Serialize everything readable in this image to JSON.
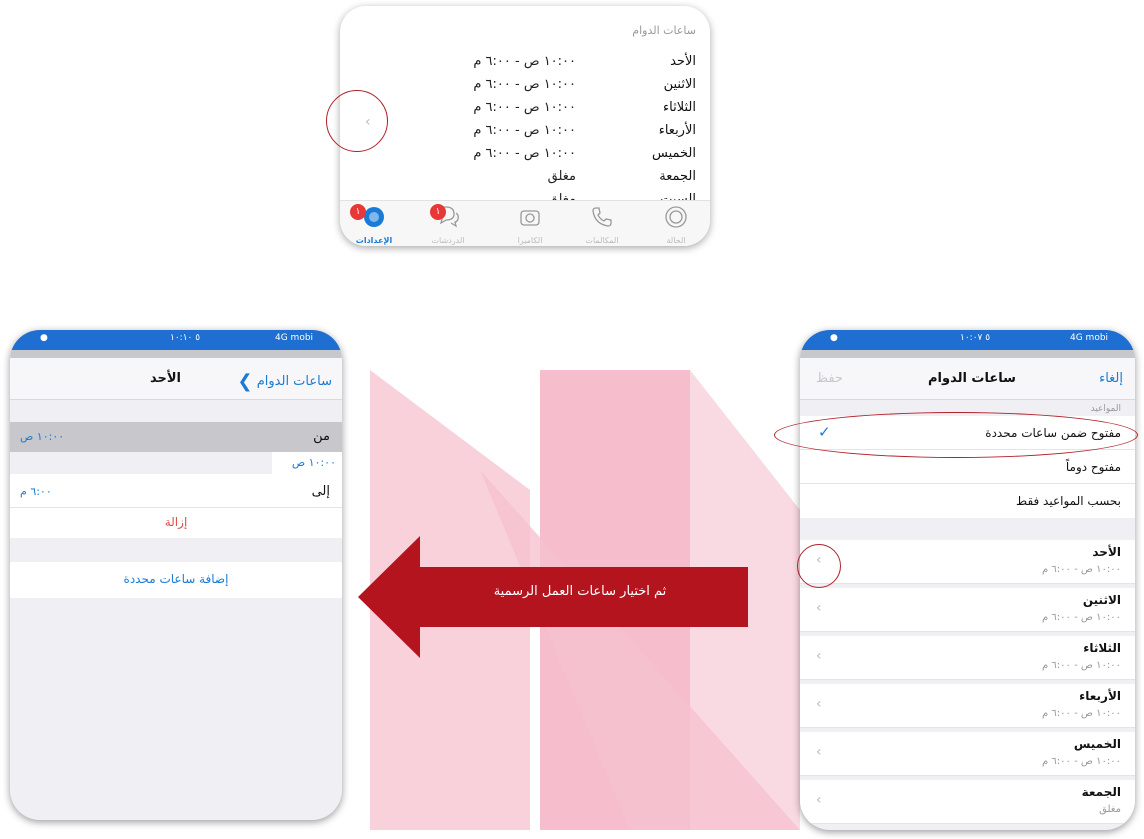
{
  "top_panel": {
    "section_title": "ساعات الدوام",
    "rows": [
      {
        "day": "الأحد",
        "hours": "١٠:٠٠ ص - ٦:٠٠ م"
      },
      {
        "day": "الاثنين",
        "hours": "١٠:٠٠ ص - ٦:٠٠ م"
      },
      {
        "day": "الثلاثاء",
        "hours": "١٠:٠٠ ص - ٦:٠٠ م"
      },
      {
        "day": "الأربعاء",
        "hours": "١٠:٠٠ ص - ٦:٠٠ م"
      },
      {
        "day": "الخميس",
        "hours": "١٠:٠٠ ص - ٦:٠٠ م"
      },
      {
        "day": "الجمعة",
        "hours": "مغلق"
      },
      {
        "day": "السبت",
        "hours": "مغلق"
      }
    ],
    "tabs": [
      {
        "label": "الإعدادات",
        "icon": "settings-icon",
        "badge": "١",
        "active": true
      },
      {
        "label": "الدردشات",
        "icon": "chats-icon",
        "badge": "١",
        "active": false
      },
      {
        "label": "الكاميرا",
        "icon": "camera-icon",
        "active": false
      },
      {
        "label": "المكالمات",
        "icon": "calls-icon",
        "active": false
      },
      {
        "label": "الحالة",
        "icon": "status-icon",
        "active": false
      }
    ]
  },
  "left_panel": {
    "status_bar": {
      "time": "٥ ١٠:١٠",
      "network": "4G mobi"
    },
    "nav": {
      "back_label": "ساعات الدوام",
      "title": "الأحد"
    },
    "from_label": "من",
    "from_value": "١٠:٠٠ ص",
    "from_picker_value": "١٠:٠٠ ص",
    "to_label": "إلى",
    "to_value": "٦:٠٠ م",
    "remove_label": "إزالة",
    "add_label": "إضافة ساعات محددة"
  },
  "right_panel": {
    "status_bar": {
      "time": "٥ ١٠:٠٧",
      "network": "4G mobi"
    },
    "nav": {
      "cancel_label": "إلغاء",
      "title": "ساعات الدوام",
      "save_label": "حفظ"
    },
    "section_label": "المواعيد",
    "options": [
      {
        "label": "مفتوح ضمن ساعات محددة",
        "checked": true
      },
      {
        "label": "مفتوح دوماً",
        "checked": false
      },
      {
        "label": "بحسب المواعيد فقط",
        "checked": false
      }
    ],
    "days": [
      {
        "day": "الأحد",
        "hours": "١٠:٠٠ ص - ٦:٠٠ م"
      },
      {
        "day": "الاثنين",
        "hours": "١٠:٠٠ ص - ٦:٠٠ م"
      },
      {
        "day": "الثلاثاء",
        "hours": "١٠:٠٠ ص - ٦:٠٠ م"
      },
      {
        "day": "الأربعاء",
        "hours": "١٠:٠٠ ص - ٦:٠٠ م"
      },
      {
        "day": "الخميس",
        "hours": "١٠:٠٠ ص - ٦:٠٠ م"
      },
      {
        "day": "الجمعة",
        "hours": "مغلق"
      }
    ]
  },
  "arrow": {
    "text": "ثم اختيار ساعات العمل الرسمية"
  },
  "colors": {
    "accent": "#1a7bd6",
    "annotation": "#b0202a",
    "arrow": "#b4141e",
    "destructive": "#e04a4a",
    "watermark": "#f3b9c8"
  }
}
